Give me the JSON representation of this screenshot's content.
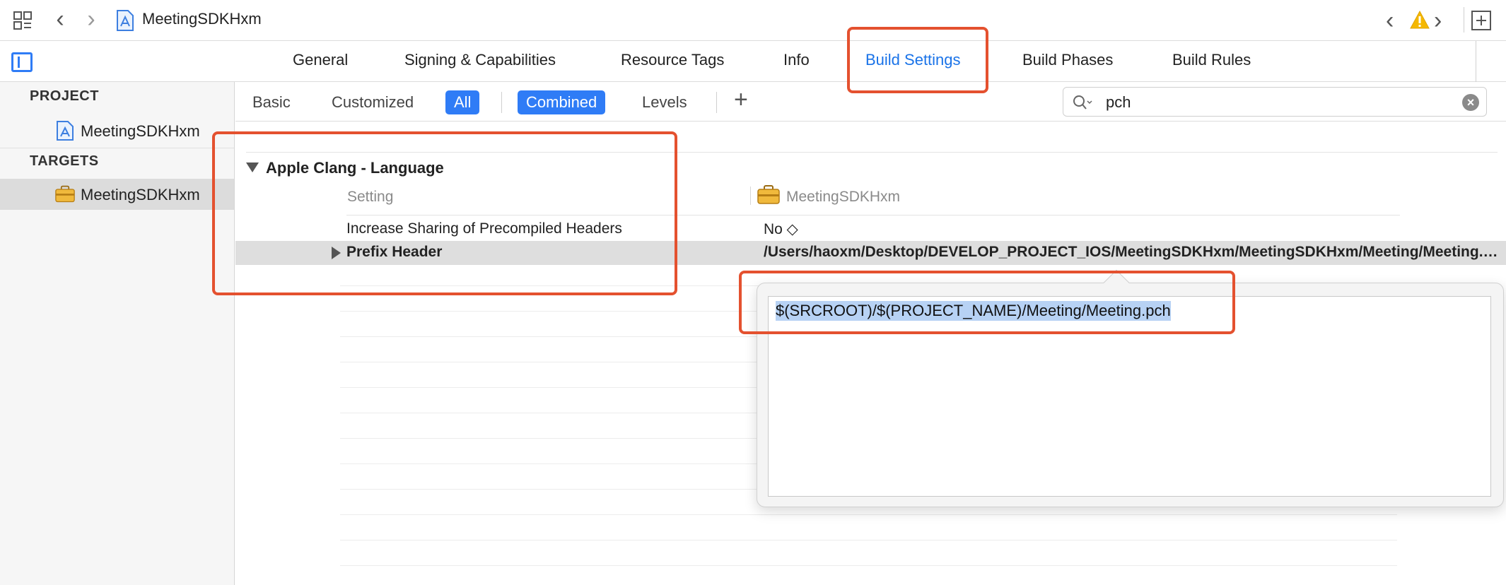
{
  "window": {
    "project_name": "MeetingSDKHxm"
  },
  "tabs": [
    {
      "label": "General"
    },
    {
      "label": "Signing & Capabilities"
    },
    {
      "label": "Resource Tags"
    },
    {
      "label": "Info"
    },
    {
      "label": "Build Settings",
      "active": true
    },
    {
      "label": "Build Phases"
    },
    {
      "label": "Build Rules"
    }
  ],
  "sidebar": {
    "project_header": "PROJECT",
    "project_item": "MeetingSDKHxm",
    "targets_header": "TARGETS",
    "target_item": "MeetingSDKHxm"
  },
  "filters": {
    "basic": "Basic",
    "customized": "Customized",
    "all": "All",
    "combined": "Combined",
    "levels": "Levels",
    "add": "+"
  },
  "search": {
    "value": "pch"
  },
  "settings": {
    "group_title": "Apple Clang - Language",
    "col_setting": "Setting",
    "col_target": "MeetingSDKHxm",
    "rows": [
      {
        "name": "Increase Sharing of Precompiled Headers",
        "value": "No ◇"
      },
      {
        "name": "Prefix Header",
        "value": "/Users/haoxm/Desktop/DEVELOP_PROJECT_IOS/MeetingSDKHxm/MeetingSDKHxm/Meeting/Meeting.pch"
      }
    ]
  },
  "popover": {
    "value": "$(SRCROOT)/$(PROJECT_NAME)/Meeting/Meeting.pch"
  },
  "colors": {
    "accent": "#2f7cf6",
    "annotation": "#e4512f",
    "warning": "#f5b800"
  }
}
